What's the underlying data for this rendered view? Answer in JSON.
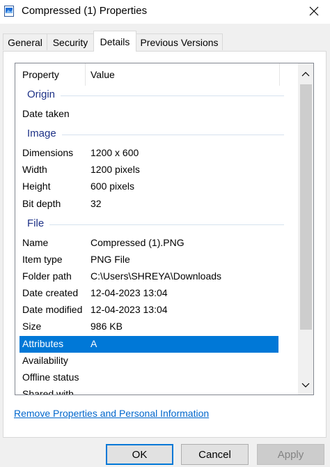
{
  "window": {
    "title": "Compressed (1) Properties",
    "icon": "image-file-icon",
    "close_icon": "close-icon"
  },
  "tabs": [
    {
      "label": "General",
      "active": false
    },
    {
      "label": "Security",
      "active": false
    },
    {
      "label": "Details",
      "active": true
    },
    {
      "label": "Previous Versions",
      "active": false
    }
  ],
  "columns": {
    "property": "Property",
    "value": "Value"
  },
  "groups": {
    "origin": "Origin",
    "image": "Image",
    "file": "File"
  },
  "rows": {
    "date_taken": {
      "k": "Date taken",
      "v": ""
    },
    "dimensions": {
      "k": "Dimensions",
      "v": "1200 x 600"
    },
    "width": {
      "k": "Width",
      "v": "1200 pixels"
    },
    "height": {
      "k": "Height",
      "v": "600 pixels"
    },
    "bit_depth": {
      "k": "Bit depth",
      "v": "32"
    },
    "name": {
      "k": "Name",
      "v": "Compressed (1).PNG"
    },
    "item_type": {
      "k": "Item type",
      "v": "PNG File"
    },
    "folder_path": {
      "k": "Folder path",
      "v": "C:\\Users\\SHREYA\\Downloads"
    },
    "date_created": {
      "k": "Date created",
      "v": "12-04-2023 13:04"
    },
    "date_modified": {
      "k": "Date modified",
      "v": "12-04-2023 13:04"
    },
    "size": {
      "k": "Size",
      "v": "986 KB"
    },
    "attributes": {
      "k": "Attributes",
      "v": "A"
    },
    "availability": {
      "k": "Availability",
      "v": ""
    },
    "offline_status": {
      "k": "Offline status",
      "v": ""
    },
    "shared_with": {
      "k": "Shared with",
      "v": ""
    }
  },
  "link": "Remove Properties and Personal Information",
  "buttons": {
    "ok": "OK",
    "cancel": "Cancel",
    "apply": "Apply"
  },
  "colors": {
    "accent": "#0078d7",
    "group_text": "#1e3287",
    "link": "#0066cc"
  }
}
